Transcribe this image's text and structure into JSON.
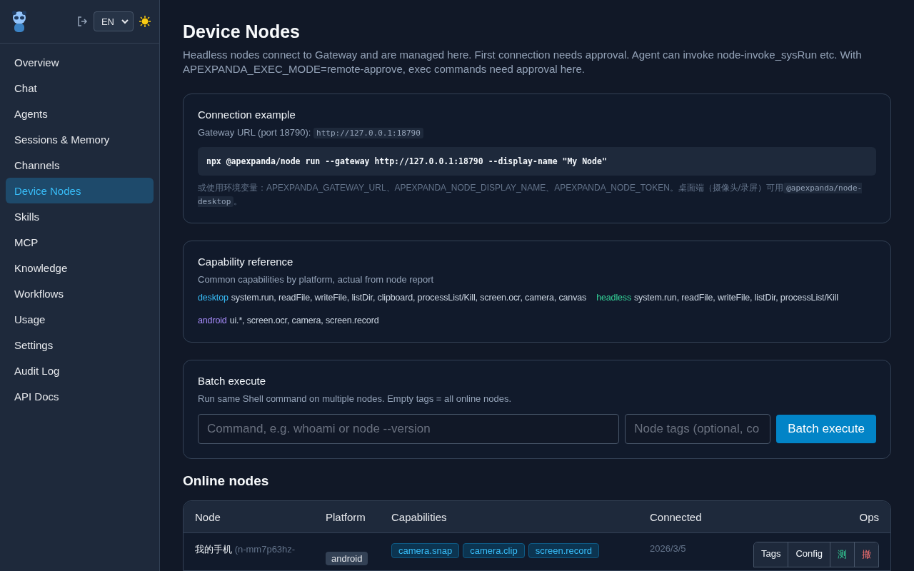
{
  "sidebar": {
    "language": "EN",
    "items": [
      {
        "label": "Overview",
        "selected": false
      },
      {
        "label": "Chat",
        "selected": false
      },
      {
        "label": "Agents",
        "selected": false
      },
      {
        "label": "Sessions & Memory",
        "selected": false
      },
      {
        "label": "Channels",
        "selected": false
      },
      {
        "label": "Device Nodes",
        "selected": true
      },
      {
        "label": "Skills",
        "selected": false
      },
      {
        "label": "MCP",
        "selected": false
      },
      {
        "label": "Knowledge",
        "selected": false
      },
      {
        "label": "Workflows",
        "selected": false
      },
      {
        "label": "Usage",
        "selected": false
      },
      {
        "label": "Settings",
        "selected": false
      },
      {
        "label": "Audit Log",
        "selected": false
      },
      {
        "label": "API Docs",
        "selected": false
      }
    ]
  },
  "page": {
    "title": "Device Nodes",
    "description": "Headless nodes connect to Gateway and are managed here. First connection needs approval. Agent can invoke node-invoke_sysRun etc. With APEXPANDA_EXEC_MODE=remote-approve, exec commands need approval here."
  },
  "connection": {
    "title": "Connection example",
    "url_label": "Gateway URL (port 18790):",
    "url": "http://127.0.0.1:18790",
    "command": "npx @apexpanda/node run --gateway http://127.0.0.1:18790 --display-name \"My Node\"",
    "note": "或使用环境变量：APEXPANDA_GATEWAY_URL、APEXPANDA_NODE_DISPLAY_NAME、APEXPANDA_NODE_TOKEN。桌面端（摄像头/录屏）可用",
    "note_code": "@apexpanda/node-desktop",
    "note_end": "。"
  },
  "capabilities": {
    "title": "Capability reference",
    "subtitle": "Common capabilities by platform, actual from node report",
    "platforms": [
      {
        "name": "desktop",
        "color": "#38bdf8",
        "caps": "system.run, readFile, writeFile, listDir, clipboard, processList/Kill, screen.ocr, camera, canvas"
      },
      {
        "name": "headless",
        "color": "#34d399",
        "caps": "system.run, readFile, writeFile, listDir, processList/Kill"
      },
      {
        "name": "android",
        "color": "#a78bfa",
        "caps": "ui.*, screen.ocr, camera, screen.record"
      }
    ]
  },
  "batch": {
    "title": "Batch execute",
    "subtitle": "Run same Shell command on multiple nodes. Empty tags = all online nodes.",
    "command_placeholder": "Command, e.g. whoami or node --version",
    "tags_placeholder": "Node tags (optional, co",
    "button": "Batch execute"
  },
  "online_nodes": {
    "title": "Online nodes",
    "columns": [
      "Node",
      "Platform",
      "Capabilities",
      "Connected",
      "Ops"
    ],
    "rows": [
      {
        "name": "我的手机",
        "id": "(n-mm7p63hz-",
        "platform": "android",
        "capabilities": [
          "camera.snap",
          "camera.clip",
          "screen.record"
        ],
        "connected": "2026/3/5",
        "ops": [
          {
            "label": "Tags",
            "kind": "plain"
          },
          {
            "label": "Config",
            "kind": "plain"
          },
          {
            "label": "测",
            "kind": "test"
          },
          {
            "label": "撤",
            "kind": "revoke"
          }
        ]
      }
    ]
  }
}
